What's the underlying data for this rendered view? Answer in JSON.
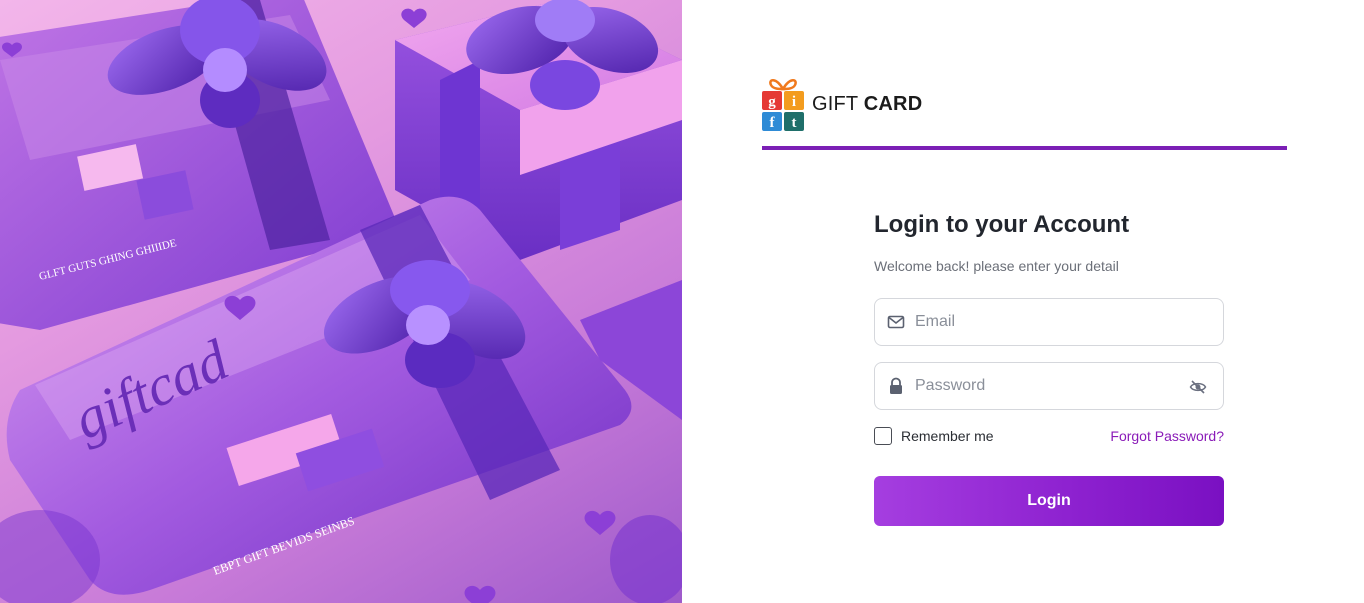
{
  "brand": {
    "logo_letters": [
      "g",
      "i",
      "f",
      "t"
    ],
    "name_light": "GIFT",
    "name_bold": "CARD",
    "accent_color": "#7b1fb5"
  },
  "hero": {
    "card_script_text": "giftcad",
    "card_band_text_1": "GLFT  GUTS GHING GHIIIDE",
    "card_band_text_2": "EBPT  GIFT  BEVIDS  SEINBS"
  },
  "login": {
    "title": "Login to your Account",
    "subtitle": "Welcome back! please enter your detail",
    "email_placeholder": "Email",
    "email_icon": "envelope-icon",
    "password_placeholder": "Password",
    "password_icon": "lock-icon",
    "visibility_icon": "eye-off-icon",
    "remember_label": "Remember me",
    "forgot_label": "Forgot Password?",
    "submit_label": "Login",
    "link_color": "#8a1bb8",
    "button_color": "#8e22d0"
  }
}
